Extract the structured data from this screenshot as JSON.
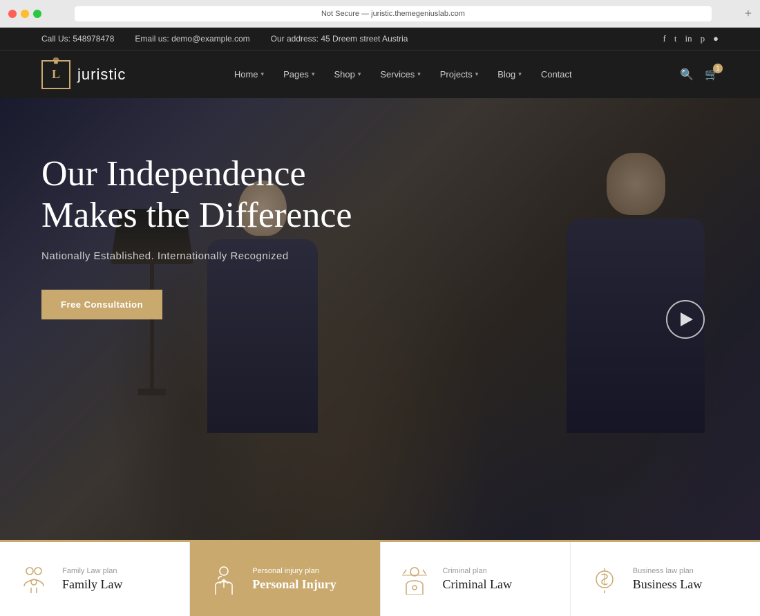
{
  "browser": {
    "url": "Not Secure — juristic.themegeniuslab.com",
    "new_tab_label": "+"
  },
  "topbar": {
    "phone": "Call Us: 548978478",
    "email": "Email us: demo@example.com",
    "address": "Our address: 45 Dreem street Austria",
    "social": [
      "f",
      "t",
      "in",
      "p",
      "●"
    ]
  },
  "nav": {
    "logo_letter": "L",
    "logo_text": "juristic",
    "items": [
      {
        "label": "Home",
        "has_dropdown": true
      },
      {
        "label": "Pages",
        "has_dropdown": true
      },
      {
        "label": "Shop",
        "has_dropdown": true
      },
      {
        "label": "Services",
        "has_dropdown": true
      },
      {
        "label": "Projects",
        "has_dropdown": true
      },
      {
        "label": "Blog",
        "has_dropdown": true
      },
      {
        "label": "Contact",
        "has_dropdown": false
      }
    ],
    "cart_count": "1"
  },
  "hero": {
    "title": "Our Independence\nMakes the Difference",
    "subtitle": "Nationally Established. Internationally Recognized",
    "cta_label": "Free Consultation"
  },
  "services": [
    {
      "label": "Family Law plan",
      "title": "Family Law",
      "active": false
    },
    {
      "label": "Personal injury plan",
      "title": "Personal Injury",
      "active": true
    },
    {
      "label": "Criminal plan",
      "title": "Criminal Law",
      "active": false
    },
    {
      "label": "Business law plan",
      "title": "Business Law",
      "active": false
    }
  ]
}
